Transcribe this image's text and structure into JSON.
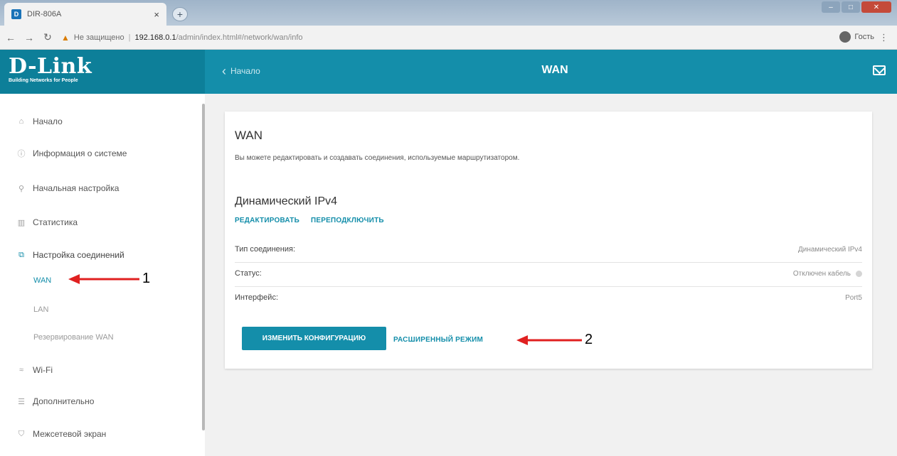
{
  "browser": {
    "tab_title": "DIR-806A",
    "tab_close": "×",
    "new_tab": "+",
    "insecure_label": "Не защищено",
    "url_host": "192.168.0.1",
    "url_path": "/admin/index.html#/network/wan/info",
    "profile_label": "Гость"
  },
  "header": {
    "logo": "D-Link",
    "tagline": "Building Networks for People",
    "back_label": "Начало",
    "page_title": "WAN"
  },
  "sidebar": {
    "items": [
      {
        "label": "Начало",
        "icon": "home-icon"
      },
      {
        "label": "Информация о системе",
        "icon": "info-icon"
      },
      {
        "label": "Начальная настройка",
        "icon": "search-icon"
      },
      {
        "label": "Статистика",
        "icon": "chart-icon"
      },
      {
        "label": "Настройка соединений",
        "icon": "connections-icon"
      },
      {
        "label": "Wi-Fi",
        "icon": "wifi-icon"
      },
      {
        "label": "Дополнительно",
        "icon": "settings-icon"
      },
      {
        "label": "Межсетевой экран",
        "icon": "shield-icon"
      }
    ],
    "subitems": [
      "WAN",
      "LAN",
      "Резервирование WAN"
    ],
    "active_subitem": "WAN"
  },
  "content": {
    "title": "WAN",
    "description": "Вы можете редактировать и создавать соединения, используемые маршрутизатором.",
    "connection_title": "Динамический IPv4",
    "edit_label": "РЕДАКТИРОВАТЬ",
    "reconnect_label": "ПЕРЕПОДКЛЮЧИТЬ",
    "rows": [
      {
        "label": "Тип соединения:",
        "value": "Динамический IPv4"
      },
      {
        "label": "Статус:",
        "value": "Отключен кабель"
      },
      {
        "label": "Интерфейс:",
        "value": "Port5"
      }
    ],
    "change_config_label": "ИЗМЕНИТЬ КОНФИГУРАЦИЮ",
    "advanced_label": "РАСШИРЕННЫЙ РЕЖИМ"
  },
  "annotations": {
    "marker_1": "1",
    "marker_2": "2"
  },
  "colors": {
    "accent": "#148eaa",
    "arrow": "#e02020"
  }
}
